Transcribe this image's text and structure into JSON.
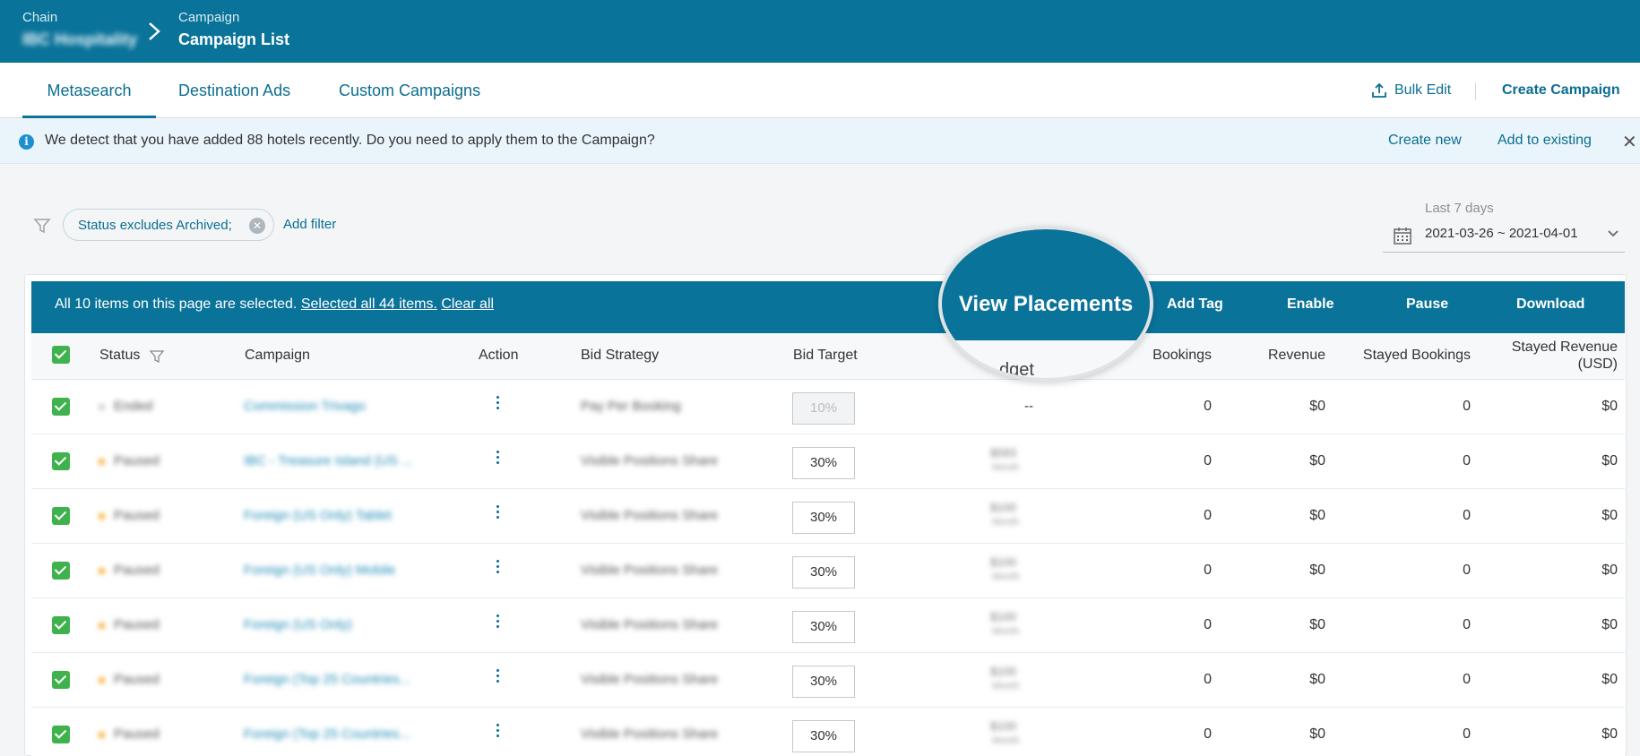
{
  "breadcrumb": {
    "chain_label": "Chain",
    "chain_value": "IBC Hospitality",
    "page_label": "Campaign",
    "page_value": "Campaign List"
  },
  "tabs": [
    {
      "label": "Metasearch",
      "active": true
    },
    {
      "label": "Destination Ads",
      "active": false
    },
    {
      "label": "Custom Campaigns",
      "active": false
    }
  ],
  "header_actions": {
    "bulk_edit": "Bulk Edit",
    "create_campaign": "Create Campaign"
  },
  "notice": {
    "text": "We detect that you have added 88 hotels recently. Do you need to apply them to the Campaign?",
    "create_new": "Create new",
    "add_existing": "Add to existing"
  },
  "filters": {
    "chip": "Status excludes Archived;",
    "add_filter": "Add filter",
    "date_label": "Last 7 days",
    "date_range": "2021-03-26 ~ 2021-04-01"
  },
  "bulk_bar": {
    "text": "All 10 items on this page are selected.",
    "select_all": "Selected all 44 items.",
    "clear_all": "Clear all",
    "actions": [
      "View Placements",
      "Add Tag",
      "Enable",
      "Pause",
      "Download"
    ]
  },
  "magnifier": {
    "label": "View Placements",
    "under": "dget"
  },
  "columns": {
    "status": "Status",
    "campaign": "Campaign",
    "action": "Action",
    "bid_strategy": "Bid Strategy",
    "bid_target": "Bid Target",
    "bookings": "Bookings",
    "revenue": "Revenue",
    "stayed_bookings": "Stayed Bookings",
    "stayed_revenue_1": "Stayed Revenue",
    "stayed_revenue_2": "(USD)"
  },
  "rows": [
    {
      "status": "Ended",
      "dot": "gray",
      "campaign": "Commission Trivago",
      "strategy": "Pay Per Booking",
      "target": "10%",
      "target_disabled": true,
      "budget": "--",
      "budget_period": "",
      "bookings": "0",
      "revenue": "$0",
      "stayed_bookings": "0",
      "stayed_revenue": "$0"
    },
    {
      "status": "Paused",
      "dot": "orange",
      "campaign": "IBC - Treasure Island (US ...",
      "strategy": "Visible Positions Share",
      "target": "30%",
      "target_disabled": false,
      "budget": "$583",
      "budget_period": "Month",
      "bookings": "0",
      "revenue": "$0",
      "stayed_bookings": "0",
      "stayed_revenue": "$0"
    },
    {
      "status": "Paused",
      "dot": "orange",
      "campaign": "Foreign (US Only) Tablet",
      "strategy": "Visible Positions Share",
      "target": "30%",
      "target_disabled": false,
      "budget": "$100",
      "budget_period": "Month",
      "bookings": "0",
      "revenue": "$0",
      "stayed_bookings": "0",
      "stayed_revenue": "$0"
    },
    {
      "status": "Paused",
      "dot": "orange",
      "campaign": "Foreign (US Only) Mobile",
      "strategy": "Visible Positions Share",
      "target": "30%",
      "target_disabled": false,
      "budget": "$100",
      "budget_period": "Month",
      "bookings": "0",
      "revenue": "$0",
      "stayed_bookings": "0",
      "stayed_revenue": "$0"
    },
    {
      "status": "Paused",
      "dot": "orange",
      "campaign": "Foreign (US Only)",
      "strategy": "Visible Positions Share",
      "target": "30%",
      "target_disabled": false,
      "budget": "$100",
      "budget_period": "Month",
      "bookings": "0",
      "revenue": "$0",
      "stayed_bookings": "0",
      "stayed_revenue": "$0"
    },
    {
      "status": "Paused",
      "dot": "orange",
      "campaign": "Foreign (Top 25 Countries...",
      "strategy": "Visible Positions Share",
      "target": "30%",
      "target_disabled": false,
      "budget": "$100",
      "budget_period": "Month",
      "bookings": "0",
      "revenue": "$0",
      "stayed_bookings": "0",
      "stayed_revenue": "$0"
    },
    {
      "status": "Paused",
      "dot": "orange",
      "campaign": "Foreign (Top 25 Countries...",
      "strategy": "Visible Positions Share",
      "target": "30%",
      "target_disabled": false,
      "budget": "$100",
      "budget_period": "Month",
      "bookings": "0",
      "revenue": "$0",
      "stayed_bookings": "0",
      "stayed_revenue": "$0"
    }
  ]
}
